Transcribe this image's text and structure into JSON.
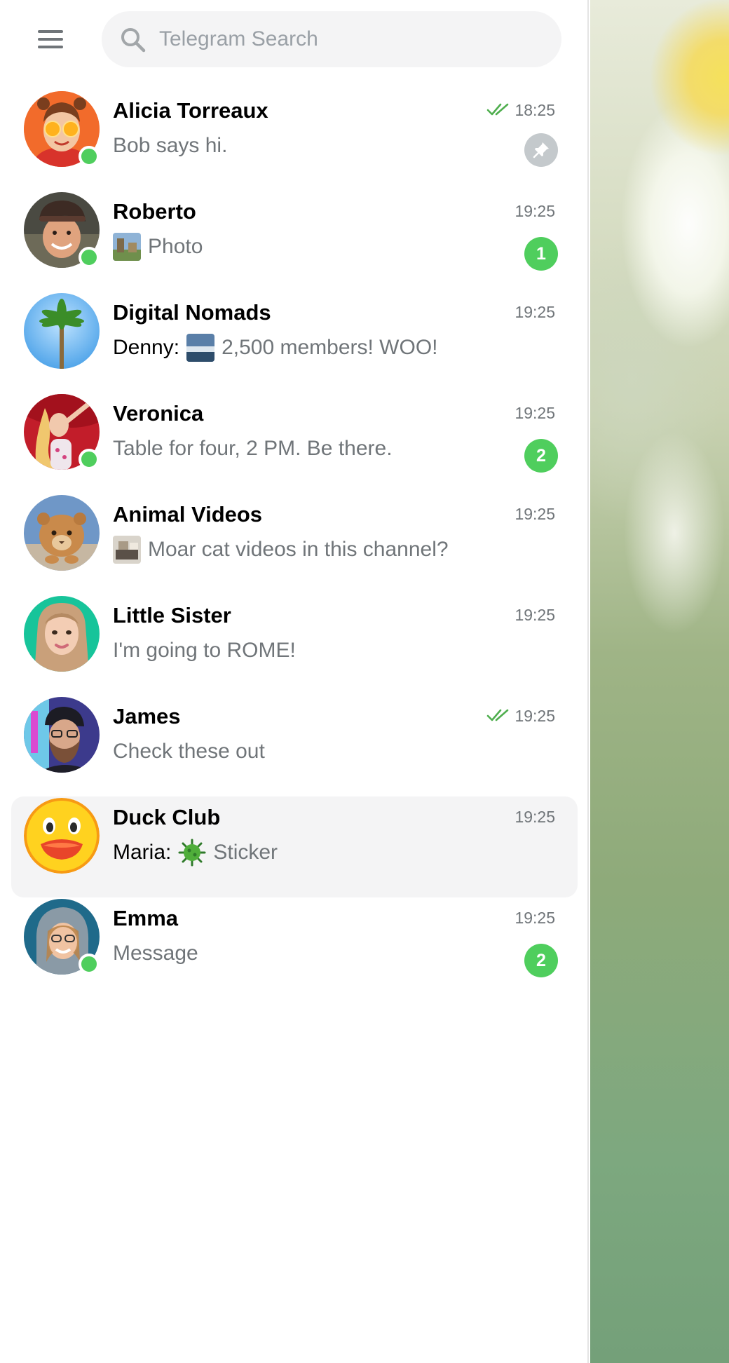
{
  "app": {
    "accent": "#4fce5d",
    "wallpaper": "blurred-yellow-flower-green-background"
  },
  "header": {
    "menu_icon": "hamburger-menu-icon",
    "search": {
      "placeholder": "Telegram Search",
      "value": "",
      "icon": "search-icon"
    }
  },
  "chats": [
    {
      "name": "Alicia Torreaux",
      "time": "18:25",
      "message": "Bob says hi.",
      "online": true,
      "read_checks": true,
      "pinned": true
    },
    {
      "name": "Roberto",
      "time": "19:25",
      "message": "Photo",
      "online": true,
      "media_thumb": "photo-thumbnail",
      "unread": "1"
    },
    {
      "name": "Digital Nomads",
      "time": "19:25",
      "sender": "Denny:",
      "message": "2,500 members! WOO!",
      "media_thumb": "photo-thumbnail"
    },
    {
      "name": "Veronica",
      "time": "19:25",
      "message": "Table for four, 2 PM. Be there.",
      "online": true,
      "unread": "2"
    },
    {
      "name": "Animal Videos",
      "time": "19:25",
      "message": "Moar cat videos in this channel?",
      "media_thumb": "video-thumbnail"
    },
    {
      "name": "Little Sister",
      "time": "19:25",
      "message": "I'm going to ROME!"
    },
    {
      "name": "James",
      "time": "19:25",
      "message": "Check these out",
      "read_checks": true
    },
    {
      "name": "Duck Club",
      "time": "19:25",
      "sender": "Maria:",
      "message": "Sticker",
      "media_thumb": "sticker-thumbnail",
      "selected": true
    },
    {
      "name": "Emma",
      "time": "19:25",
      "message": "Message",
      "online": true,
      "unread": "2"
    }
  ]
}
